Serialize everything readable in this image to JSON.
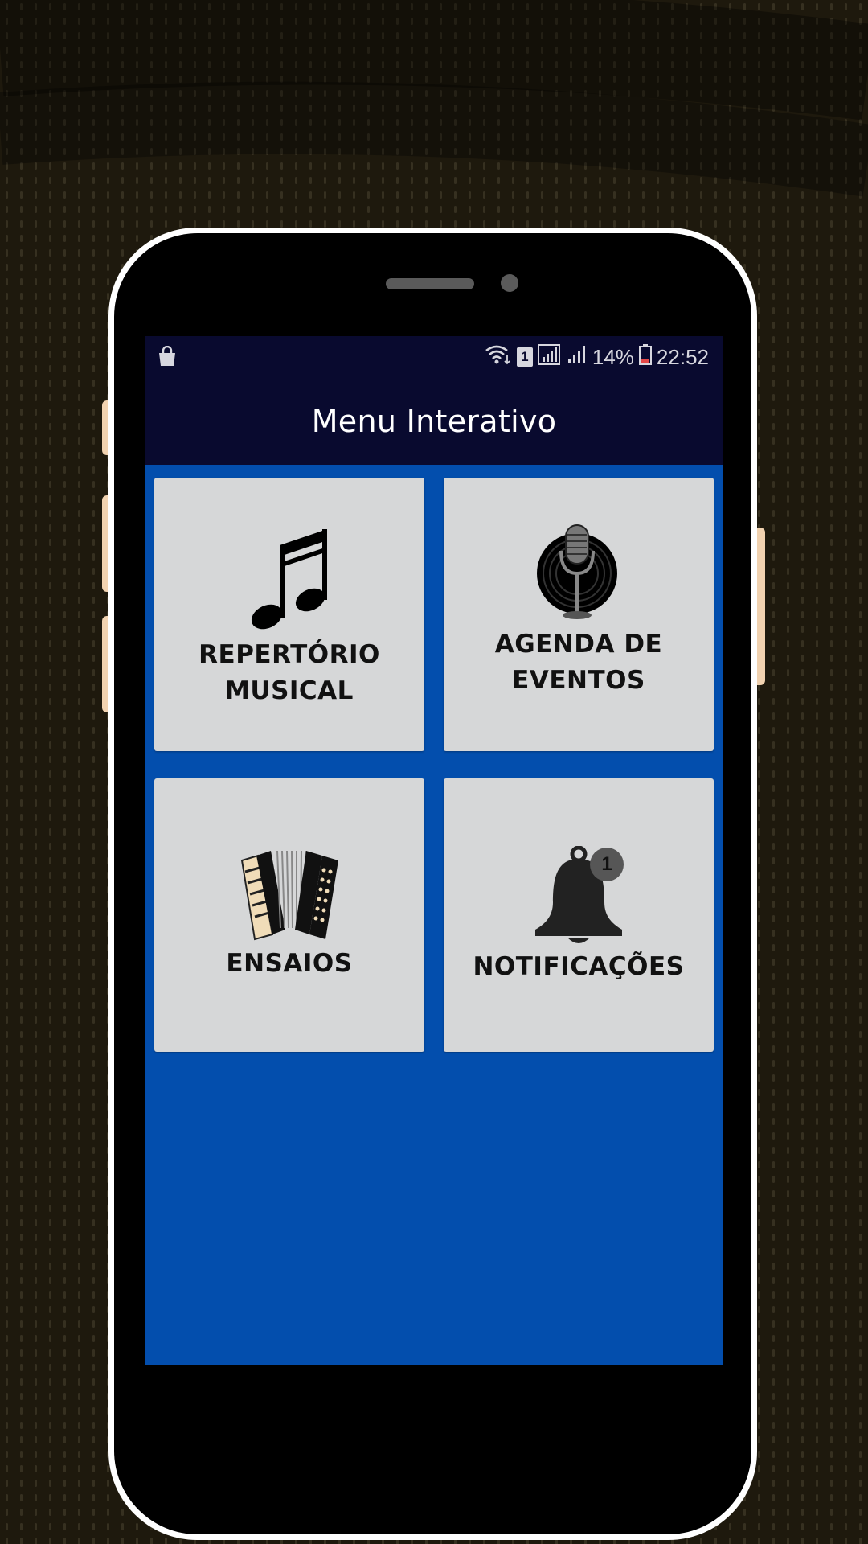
{
  "status_bar": {
    "battery_percent": "14%",
    "sim_slot": "1",
    "time": "22:52",
    "left_icon": "shopping-bag-icon",
    "icons": [
      "wifi-icon",
      "sim-icon",
      "signal-icon",
      "signal-weak-icon",
      "battery-icon"
    ]
  },
  "app_bar": {
    "title": "Menu Interativo"
  },
  "tiles": [
    {
      "label": "REPERTÓRIO\nMUSICAL",
      "icon": "music-note-icon"
    },
    {
      "label": "AGENDA DE\nEVENTOS",
      "icon": "microphone-vinyl-icon"
    },
    {
      "label": "ENSAIOS",
      "icon": "accordion-icon"
    },
    {
      "label": "NOTIFICAÇÕES",
      "icon": "bell-icon",
      "badge": "1"
    }
  ],
  "colors": {
    "background": "#1e190d",
    "app_bar": "#090a2f",
    "screen": "#034ead",
    "tile": "#d6d7d8",
    "phone_frame": "#ffffff"
  }
}
